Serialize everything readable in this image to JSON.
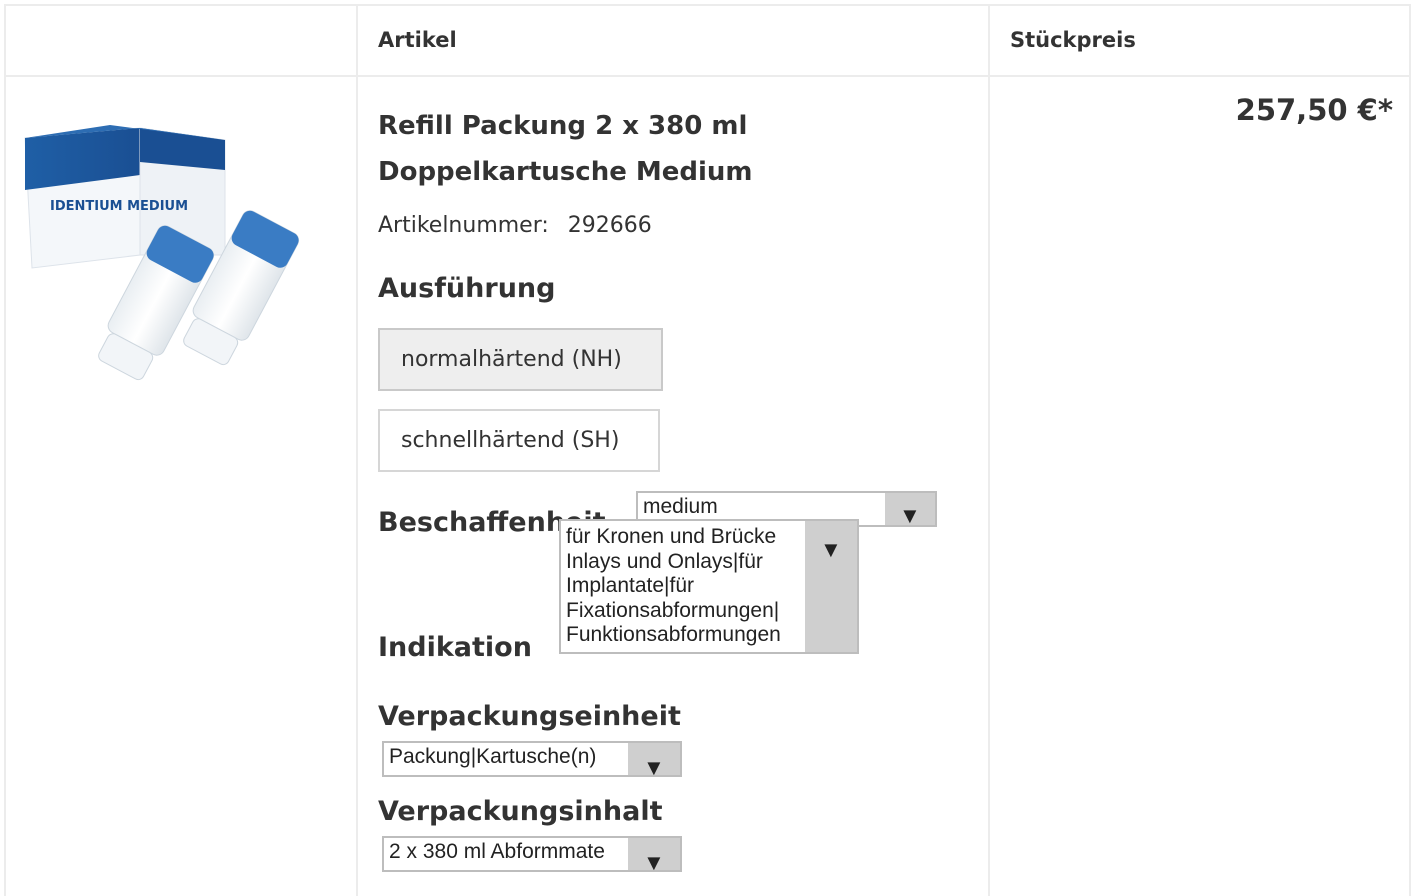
{
  "table": {
    "headers": {
      "article": "Artikel",
      "unit_price": "Stückpreis"
    }
  },
  "product": {
    "image_alt": "IDENTIUM MEDIUM",
    "title_line1": "Refill Packung 2 x 380 ml",
    "title_line2": "Doppelkartusche Medium",
    "article_number_label": "Artikelnummer:",
    "article_number": "292666",
    "price": "257,50 €*"
  },
  "ausfuehrung": {
    "label": "Ausführung",
    "options": [
      {
        "label": "normalhärtend (NH)",
        "selected": true
      },
      {
        "label": "schnellhärtend (SH)",
        "selected": false
      }
    ]
  },
  "beschaffenheit": {
    "label": "Beschaffenheit",
    "selected": "medium"
  },
  "indikation": {
    "label": "Indikation",
    "selected_lines": [
      "für Kronen und Brücke",
      "Inlays und Onlays|für",
      "Implantate|für",
      "Fixationsabformungen|",
      "Funktionsabformungen"
    ]
  },
  "verpackungseinheit": {
    "label": "Verpackungseinheit",
    "selected": "Packung|Kartusche(n)"
  },
  "verpackungsinhalt": {
    "label": "Verpackungsinhalt",
    "selected": "2 x 380 ml Abformmate"
  },
  "icons": {
    "dropdown": "triangle-down"
  },
  "colors": {
    "border": "#ececec",
    "selected_button_bg": "#eeeeee",
    "arrow_box": "#cfcfcf"
  }
}
